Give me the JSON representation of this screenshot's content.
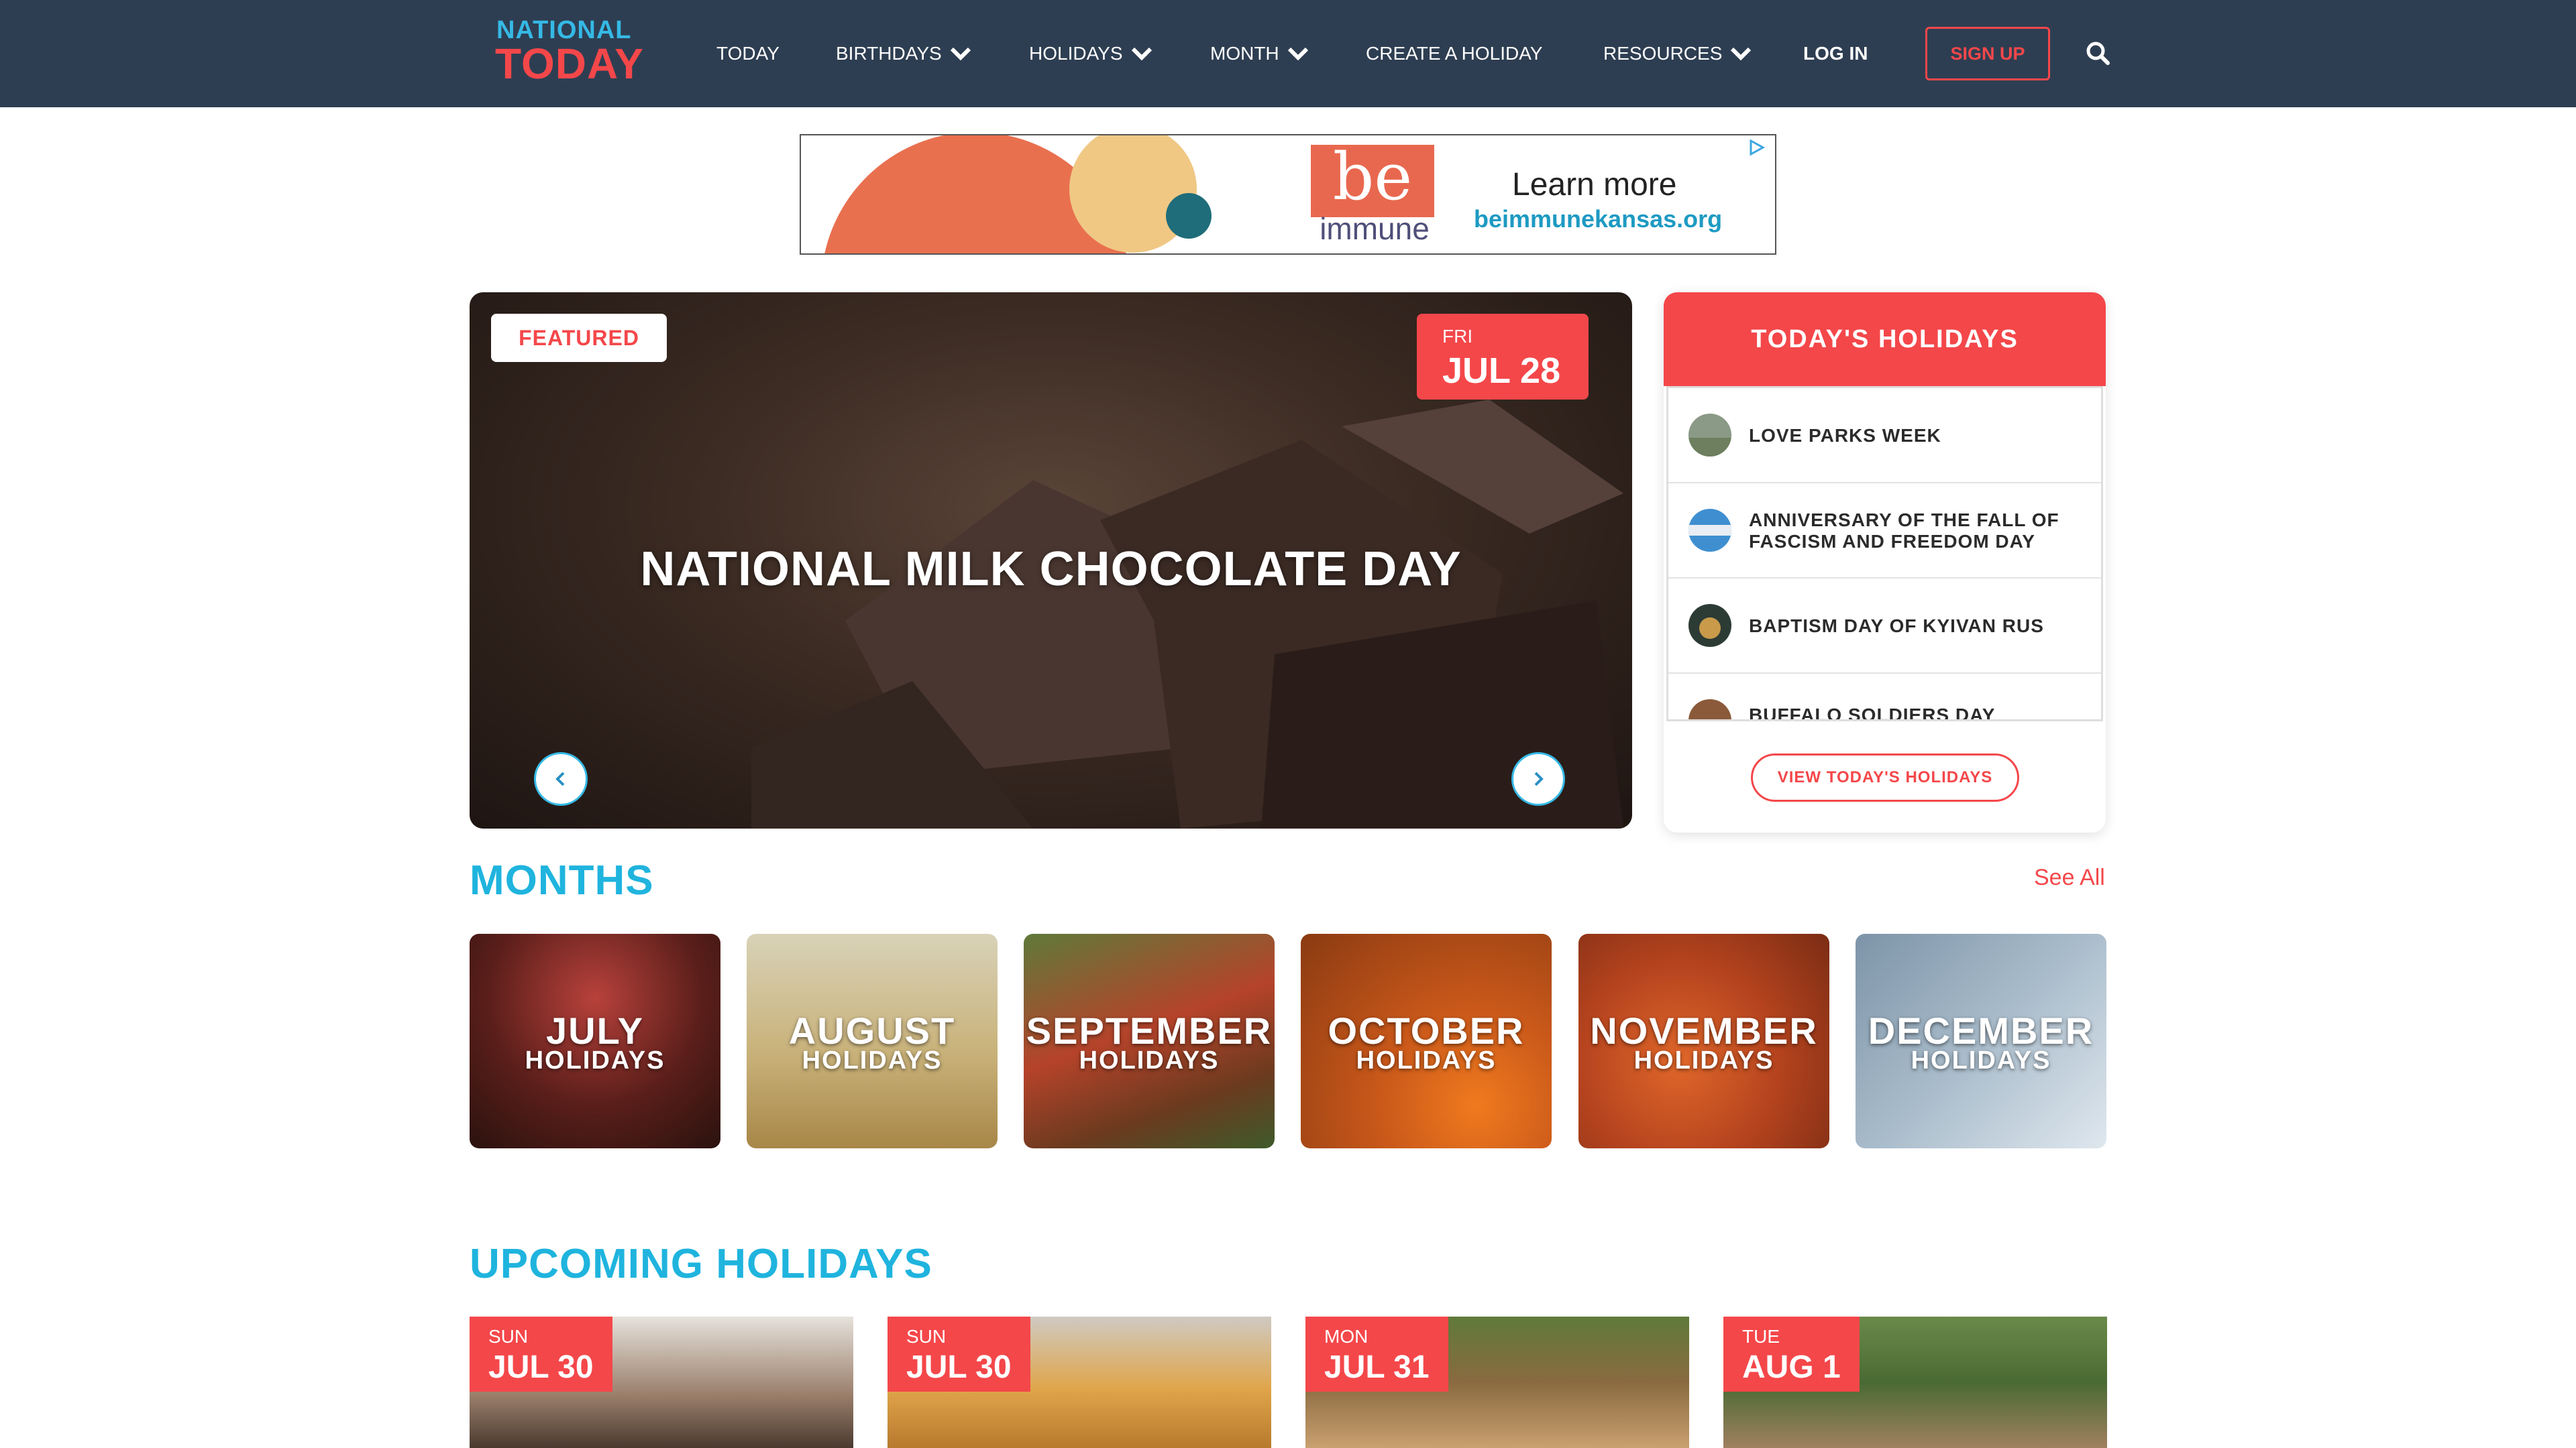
{
  "header": {
    "logo_line1": "NATIONAL",
    "logo_line2": "TODAY",
    "nav": {
      "today": "TODAY",
      "birthdays": "BIRTHDAYS",
      "holidays": "HOLIDAYS",
      "month": "MONTH",
      "create": "CREATE A HOLIDAY",
      "resources": "RESOURCES",
      "login": "LOG IN"
    },
    "signup": "SIGN UP"
  },
  "ad": {
    "brand_top": "be",
    "brand_bottom": "immune",
    "cta": "Learn more",
    "url": "beimmunekansas.org"
  },
  "featured": {
    "badge": "FEATURED",
    "day_of_week": "FRI",
    "date": "JUL 28",
    "title": "NATIONAL MILK CHOCOLATE DAY"
  },
  "todays_holidays": {
    "heading": "TODAY'S HOLIDAYS",
    "items": [
      {
        "label": "LOVE PARKS WEEK"
      },
      {
        "label": "ANNIVERSARY OF THE FALL OF FASCISM AND FREEDOM DAY"
      },
      {
        "label": "BAPTISM DAY OF KYIVAN RUS"
      },
      {
        "label": "BUFFALO SOLDIERS DAY"
      }
    ],
    "view_button": "VIEW TODAY'S HOLIDAYS"
  },
  "months": {
    "title": "MONTHS",
    "see_all": "See All",
    "items": [
      {
        "name": "JULY",
        "sub": "HOLIDAYS"
      },
      {
        "name": "AUGUST",
        "sub": "HOLIDAYS"
      },
      {
        "name": "SEPTEMBER",
        "sub": "HOLIDAYS"
      },
      {
        "name": "OCTOBER",
        "sub": "HOLIDAYS"
      },
      {
        "name": "NOVEMBER",
        "sub": "HOLIDAYS"
      },
      {
        "name": "DECEMBER",
        "sub": "HOLIDAYS"
      }
    ]
  },
  "upcoming": {
    "title": "UPCOMING HOLIDAYS",
    "items": [
      {
        "dow": "SUN",
        "date": "JUL 30"
      },
      {
        "dow": "SUN",
        "date": "JUL 30"
      },
      {
        "dow": "MON",
        "date": "JUL 31"
      },
      {
        "dow": "TUE",
        "date": "AUG 1"
      }
    ]
  },
  "colors": {
    "header_bg": "#2e3e52",
    "brand_red": "#f4474a",
    "brand_blue": "#1fb4de"
  }
}
